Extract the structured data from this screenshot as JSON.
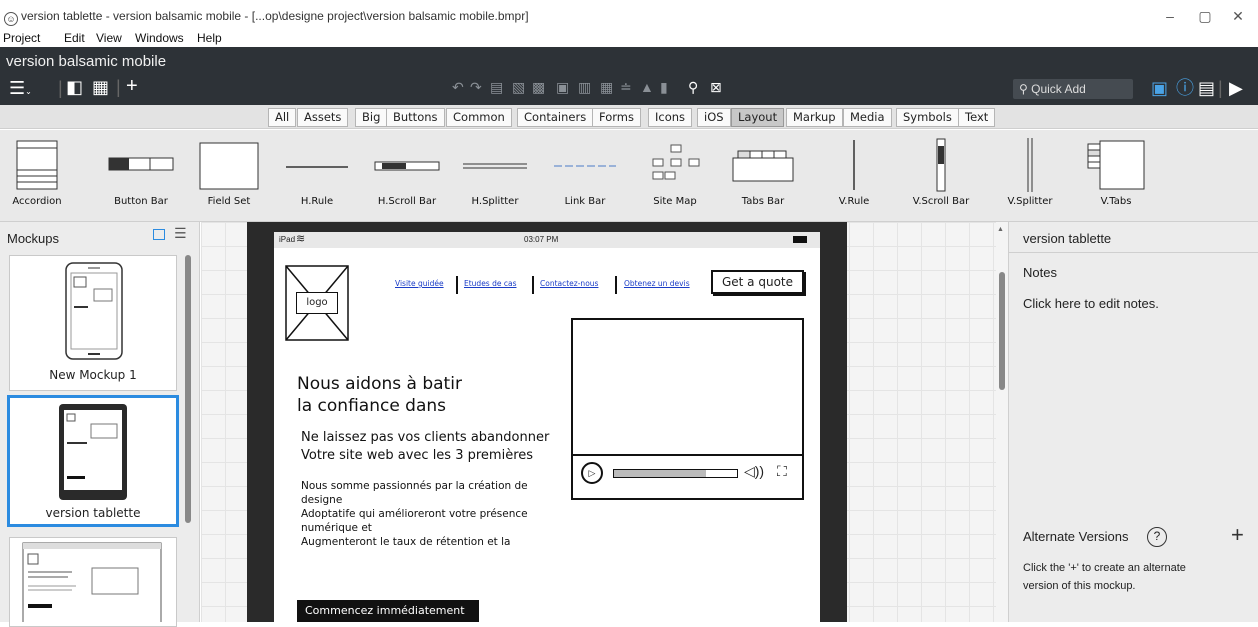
{
  "window": {
    "title": "version tablette - version balsamic mobile - [...op\\designe project\\version balsamic mobile.bmpr]",
    "minimize": "–",
    "restore": "▢",
    "close": "✕"
  },
  "menu": [
    "Project",
    "Edit",
    "View",
    "Windows",
    "Help"
  ],
  "app": {
    "project_name": "version balsamic mobile",
    "quick_add_label": "Quick Add"
  },
  "categories": [
    {
      "label": "All"
    },
    {
      "label": "Assets"
    },
    {
      "label": "Big"
    },
    {
      "label": "Buttons"
    },
    {
      "label": "Common"
    },
    {
      "label": "Containers"
    },
    {
      "label": "Forms"
    },
    {
      "label": "Icons"
    },
    {
      "label": "iOS"
    },
    {
      "label": "Layout",
      "active": true
    },
    {
      "label": "Markup"
    },
    {
      "label": "Media"
    },
    {
      "label": "Symbols"
    },
    {
      "label": "Text"
    }
  ],
  "library": [
    "Accordion",
    "Button Bar",
    "Field Set",
    "H.Rule",
    "H.Scroll Bar",
    "H.Splitter",
    "Link Bar",
    "Site Map",
    "Tabs Bar",
    "V.Rule",
    "V.Scroll Bar",
    "V.Splitter",
    "V.Tabs"
  ],
  "mockups_panel": {
    "header": "Mockups",
    "items": [
      "New Mockup 1",
      "version tablette"
    ]
  },
  "mockup": {
    "status_left": "iPad",
    "status_time": "03:07 PM",
    "logo": "logo",
    "links": [
      "Visite guidée",
      "Etudes de cas",
      "Contactez-nous",
      "Obtenez un devis"
    ],
    "cta": "Get a quote",
    "headline_1": "Nous aidons à batir",
    "headline_2": "la confiance dans",
    "sub_1": "Ne laissez pas vos clients abandonner",
    "sub_2": "Votre site web avec les 3 premières",
    "body_1": "Nous somme passionnés par la création de",
    "body_2": "designe",
    "body_3": "Adoptatife qui amélioreront votre présence",
    "body_4": "numérique et",
    "body_5": "Augmenteront le taux de rétention et la",
    "start_button": "Commencez immédiatement"
  },
  "right_panel": {
    "title": "version tablette",
    "notes_label": "Notes",
    "notes_hint": "Click here to edit notes.",
    "alt_versions": "Alternate Versions",
    "alt_help": "?",
    "alt_add": "+",
    "alt_hint_1": "Click the '+' to create an alternate",
    "alt_hint_2": "version of this mockup."
  }
}
